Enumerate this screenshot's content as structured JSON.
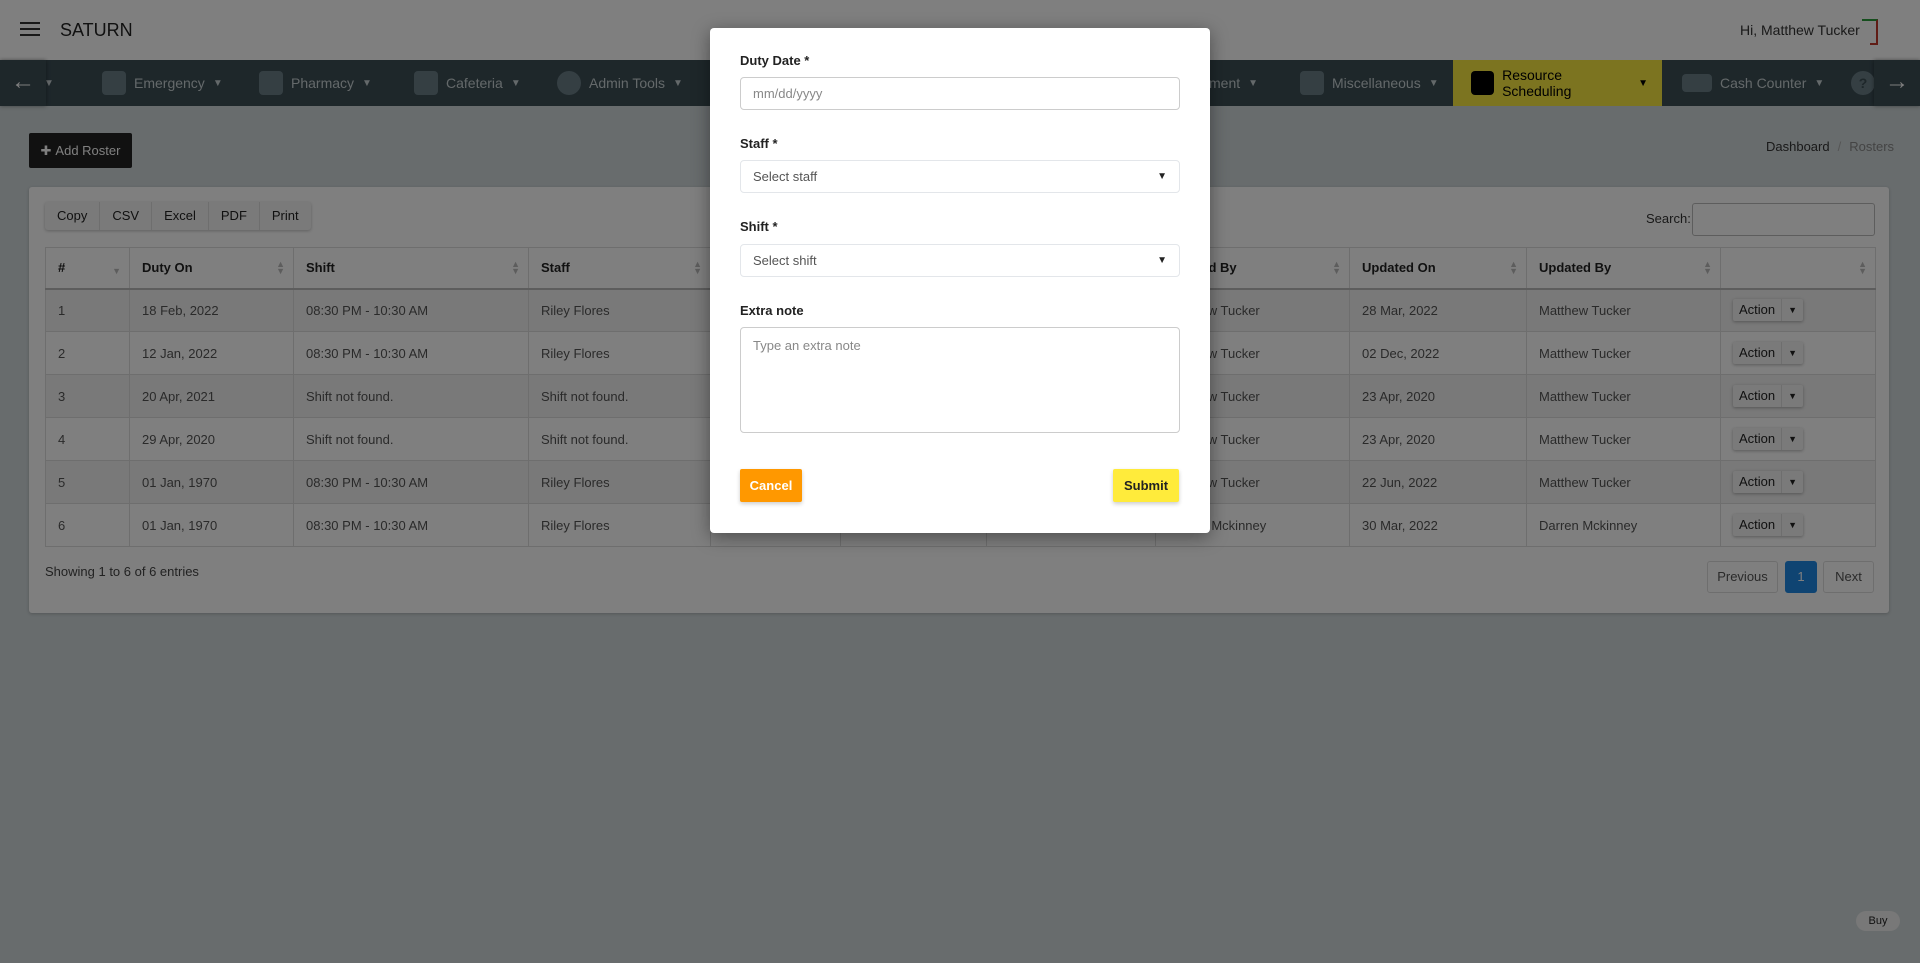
{
  "header": {
    "brand": "SATURN",
    "greeting": "Hi, Matthew Tucker"
  },
  "navbar": {
    "items": [
      {
        "label": "Emergency",
        "icon": "wheelchair-icon"
      },
      {
        "label": "Pharmacy",
        "icon": "medkit-icon"
      },
      {
        "label": "Cafeteria",
        "icon": "cutlery-icon"
      },
      {
        "label": "Admin Tools",
        "icon": "user-icon"
      },
      {
        "label": "ment",
        "icon": ""
      },
      {
        "label": "Miscellaneous",
        "icon": "doctor-icon"
      },
      {
        "label": "Resource Scheduling",
        "icon": "calendar-icon",
        "active": true
      },
      {
        "label": "Cash Counter",
        "icon": "money-icon"
      }
    ],
    "active_color": "#f8e840"
  },
  "toolbar": {
    "add_roster": "Add Roster"
  },
  "breadcrumb": {
    "items": [
      "Dashboard",
      "Rosters"
    ],
    "separator": "/"
  },
  "export_buttons": [
    "Copy",
    "CSV",
    "Excel",
    "PDF",
    "Print"
  ],
  "search": {
    "label": "Search:",
    "value": ""
  },
  "table": {
    "columns": [
      "#",
      "Duty On",
      "Shift",
      "Staff",
      "",
      "",
      "",
      "Created By",
      "Updated On",
      "Updated By",
      ""
    ],
    "rows": [
      [
        "1",
        "18 Feb, 2022",
        "08:30 PM - 10:30 AM",
        "Riley Flores",
        "",
        "",
        "",
        "Matthew Tucker",
        "28 Mar, 2022",
        "Matthew Tucker"
      ],
      [
        "2",
        "12 Jan, 2022",
        "08:30 PM - 10:30 AM",
        "Riley Flores",
        "",
        "",
        "",
        "Matthew Tucker",
        "02 Dec, 2022",
        "Matthew Tucker"
      ],
      [
        "3",
        "20 Apr, 2021",
        "Shift not found.",
        "Shift not found.",
        "",
        "",
        "",
        "Matthew Tucker",
        "23 Apr, 2020",
        "Matthew Tucker"
      ],
      [
        "4",
        "29 Apr, 2020",
        "Shift not found.",
        "Shift not found.",
        "",
        "",
        "",
        "Matthew Tucker",
        "23 Apr, 2020",
        "Matthew Tucker"
      ],
      [
        "5",
        "01 Jan, 1970",
        "08:30 PM - 10:30 AM",
        "Riley Flores",
        "",
        "",
        "",
        "Matthew Tucker",
        "22 Jun, 2022",
        "Matthew Tucker"
      ],
      [
        "6",
        "01 Jan, 1970",
        "08:30 PM - 10:30 AM",
        "Riley Flores",
        "",
        "",
        "",
        "Darren Mckinney",
        "30 Mar, 2022",
        "Darren Mckinney"
      ]
    ],
    "action_label": "Action"
  },
  "footer": {
    "showing": "Showing 1 to 6 of 6 entries",
    "previous": "Previous",
    "current_page": "1",
    "next": "Next"
  },
  "buy_badge": "Buy",
  "modal": {
    "duty_date_label": "Duty Date *",
    "duty_date_placeholder": "mm/dd/yyyy",
    "staff_label": "Staff *",
    "staff_value": "Select staff",
    "shift_label": "Shift *",
    "shift_value": "Select shift",
    "note_label": "Extra note",
    "note_placeholder": "Type an extra note",
    "cancel": "Cancel",
    "submit": "Submit",
    "cancel_color": "#ff9800",
    "submit_color": "#ffeb3b"
  }
}
